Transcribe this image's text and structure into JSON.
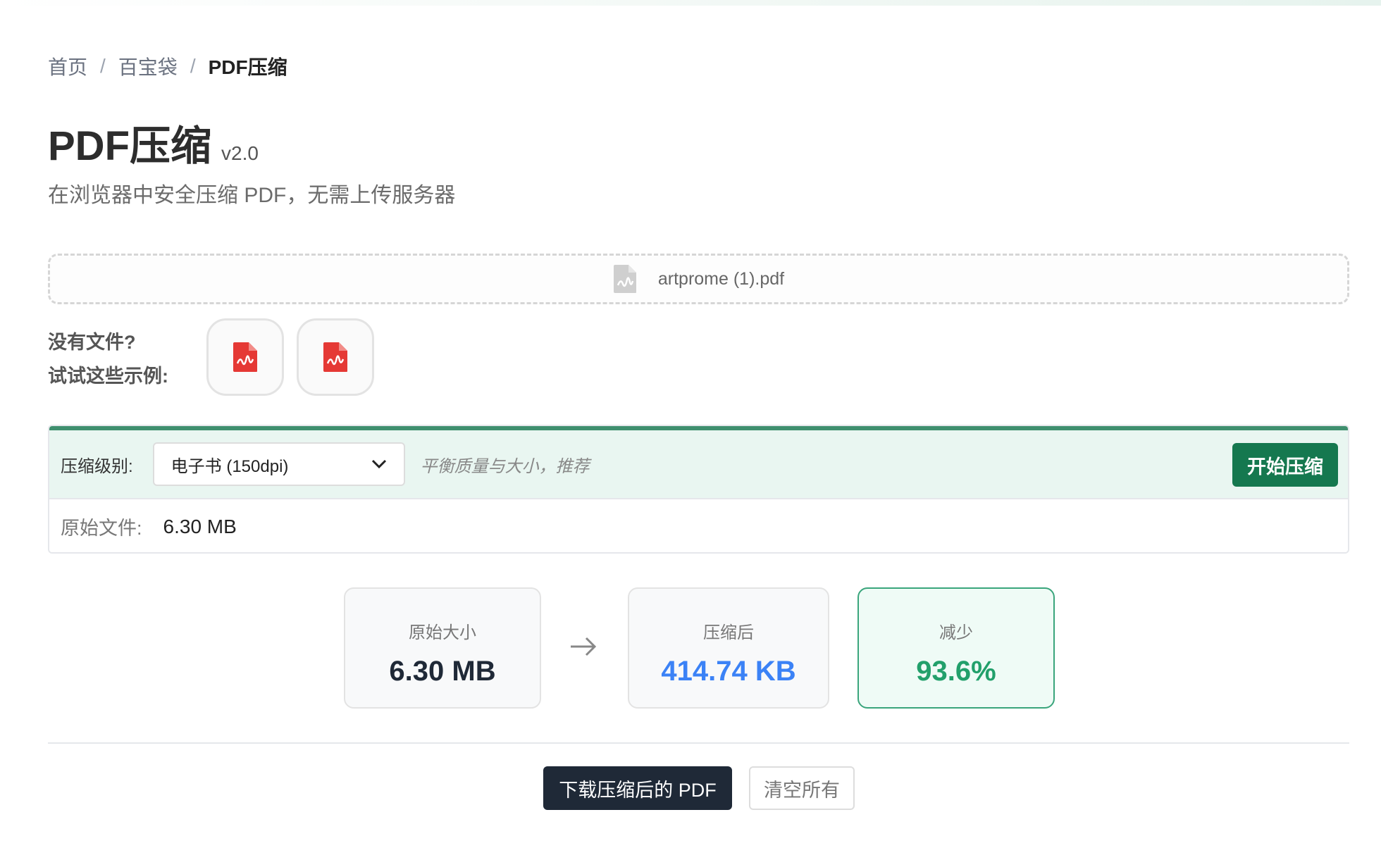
{
  "breadcrumb": {
    "items": [
      "首页",
      "百宝袋"
    ],
    "separator": "/",
    "current": "PDF压缩"
  },
  "header": {
    "title": "PDF压缩",
    "version": "v2.0",
    "subtitle": "在浏览器中安全压缩 PDF，无需上传服务器"
  },
  "dropzone": {
    "file_name": "artprome (1).pdf",
    "icon": "pdf-file-icon"
  },
  "examples": {
    "label_line1": "没有文件?",
    "label_line2": "试试这些示例:",
    "items": [
      {
        "icon": "pdf-file-icon",
        "color": "#e53935"
      },
      {
        "icon": "pdf-file-icon",
        "color": "#e53935"
      }
    ]
  },
  "settings": {
    "level_label": "压缩级别:",
    "level_value": "电子书 (150dpi)",
    "hint": "平衡质量与大小，推荐",
    "start_label": "开始压缩",
    "original_label": "原始文件:",
    "original_value": "6.30 MB"
  },
  "stats": {
    "original": {
      "label": "原始大小",
      "value": "6.30 MB",
      "color": "#1f2937"
    },
    "compressed": {
      "label": "压缩后",
      "value": "414.74 KB",
      "color": "#3b82f6"
    },
    "reduced": {
      "label": "减少",
      "value": "93.6%",
      "color": "#22a06b"
    }
  },
  "actions": {
    "download_label": "下载压缩后的 PDF",
    "clear_label": "清空所有"
  },
  "colors": {
    "accent": "#15784f",
    "settings_bg": "#e9f6f1",
    "pdf_red": "#e53935"
  }
}
